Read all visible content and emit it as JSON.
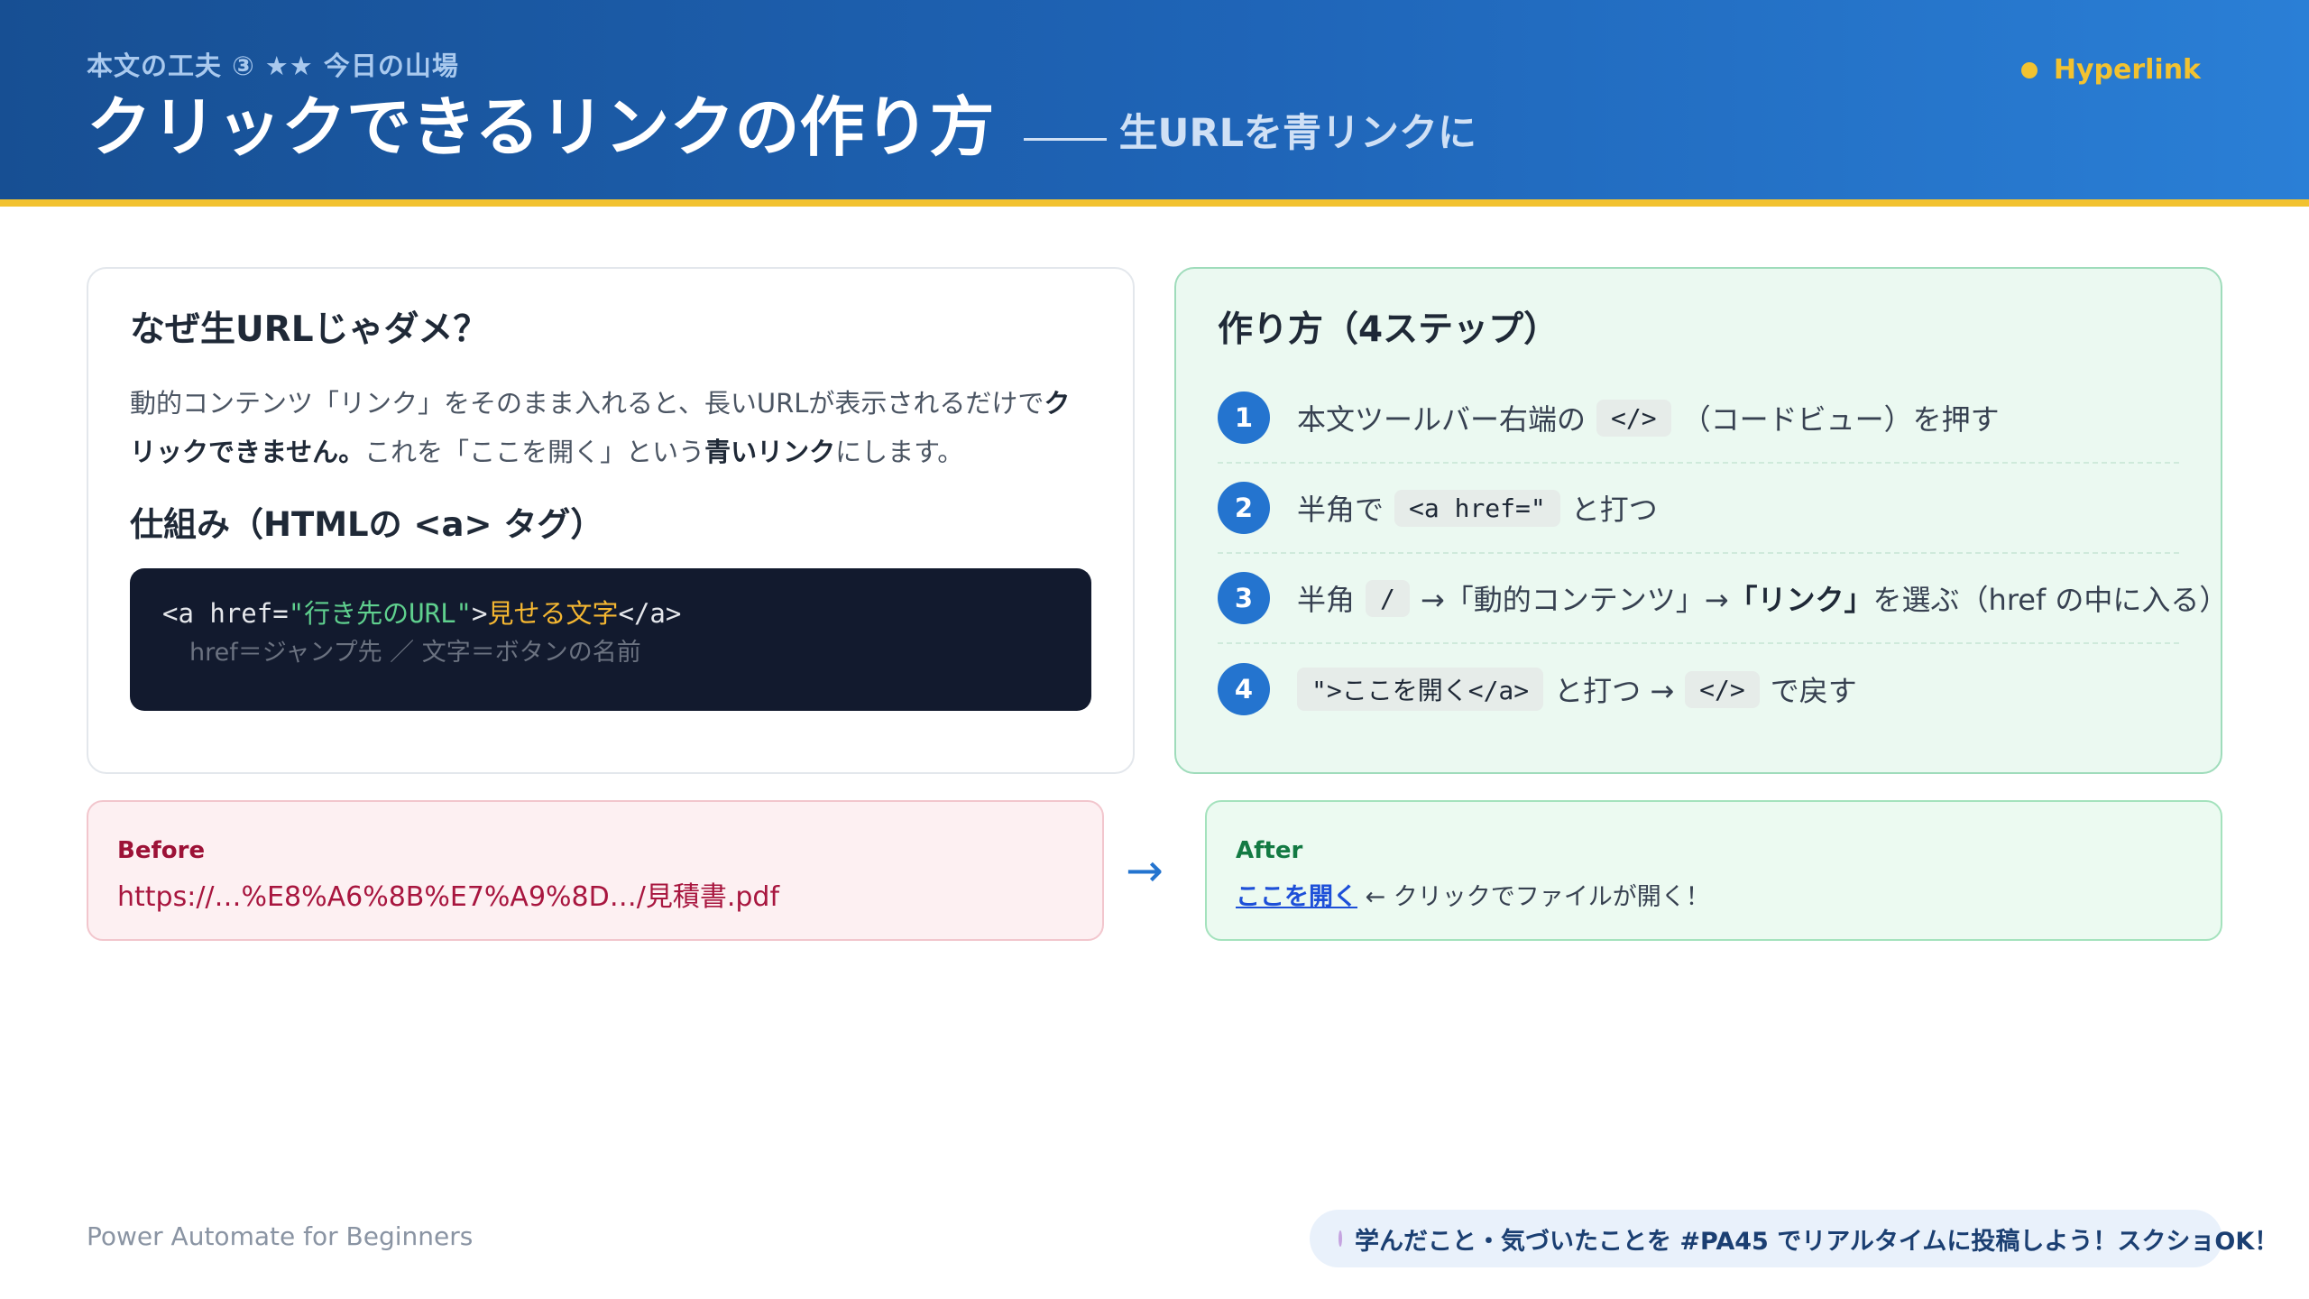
{
  "header": {
    "kicker": "本文の工夫 ③ ★★ 今日の山場",
    "title": "クリックできるリンクの作り方",
    "subtitle": "生URLを青リンクに",
    "badge": "Hyperlink"
  },
  "why": {
    "heading": "なぜ生URLじゃダメ？",
    "text_1": "動的コンテンツ「リンク」をそのまま入れると、長いURLが表示されるだけで",
    "text_2_bold": "クリックできません。",
    "text_3": "これを「ここを開く」という",
    "text_4_bold": "青いリンク",
    "text_5": "にします。",
    "mechanism_heading": "仕組み（HTMLの <a> タグ）",
    "code": {
      "open": "<a href=",
      "url": "\"行き先のURL\"",
      "gt": ">",
      "text": "見せる文字",
      "close": "</a>",
      "note": "href＝ジャンプ先 ／ 文字＝ボタンの名前"
    }
  },
  "howto": {
    "heading": "作り方（4ステップ）",
    "steps": [
      {
        "num": "1",
        "pre": "本文ツールバー右端の",
        "code": "</>",
        "post": "（コードビュー）を押す"
      },
      {
        "num": "2",
        "pre": "半角で",
        "code": "<a href=\"",
        "post": "と打つ"
      },
      {
        "num": "3",
        "pre": "半角",
        "code": "/",
        "mid": "→「動的コンテンツ」→",
        "bold": "「リンク」",
        "post": "を選ぶ（href の中に入る）"
      },
      {
        "num": "4",
        "code": "\">ここを開く</a>",
        "mid": "と打つ →",
        "code2": "</>",
        "post": "で戻す"
      }
    ]
  },
  "before": {
    "label": "Before",
    "value": "https://…%E8%A6%8B%E7%A9%8D…/見積書.pdf"
  },
  "after": {
    "label": "After",
    "link": "ここを開く",
    "note": "← クリックでファイルが開く！"
  },
  "footer": {
    "left": "Power Automate for Beginners",
    "pill": "学んだこと・気づいたことを #PA45 でリアルタイムに投稿しよう！スクショOK！"
  },
  "colors": {
    "header_start": "#174f93",
    "header_end": "#2a7fd6",
    "accent_yellow": "#f2c230",
    "step_blue": "#2474cf",
    "before_red": "#a8163f",
    "after_green": "#137a43"
  }
}
